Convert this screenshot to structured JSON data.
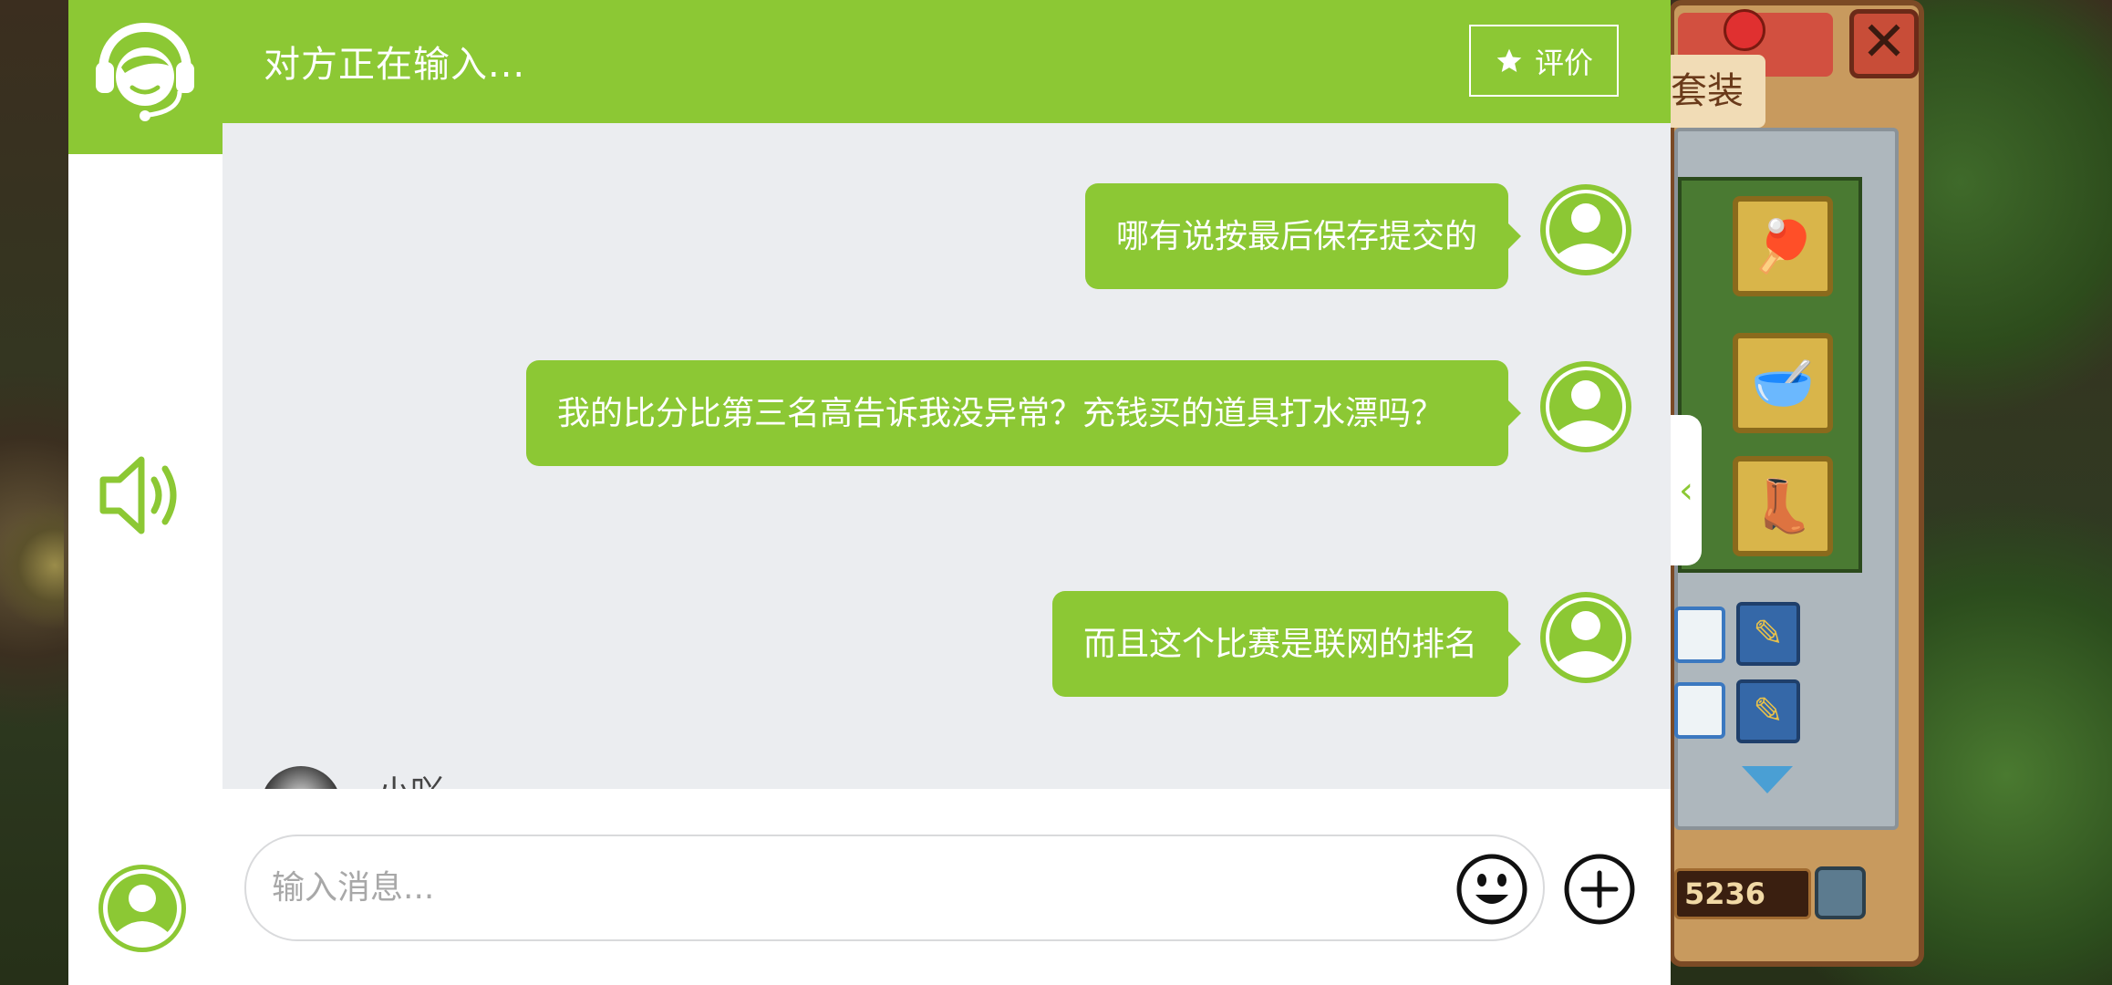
{
  "header": {
    "status": "对方正在输入...",
    "rate_label": "评价",
    "logo_icon": "customer-service-headset-icon"
  },
  "sidebar": {
    "speaker_icon": "speaker-volume-icon",
    "user_icon": "user-profile-icon"
  },
  "messages": [
    {
      "from": "user",
      "text": "哪有说按最后保存提交的"
    },
    {
      "from": "user",
      "text": "我的比分比第三名高告诉我没异常？充钱买的道具打水漂吗？"
    },
    {
      "from": "user",
      "text": "而且这个比赛是联网的排名"
    }
  ],
  "agent_peek": {
    "name": "小吖"
  },
  "composer": {
    "placeholder": "输入消息..."
  },
  "game": {
    "tab_label": "套装",
    "score": "5236"
  },
  "colors": {
    "accent": "#8cc834",
    "background": "#ebedf0",
    "bubble_text": "#ffffff"
  }
}
